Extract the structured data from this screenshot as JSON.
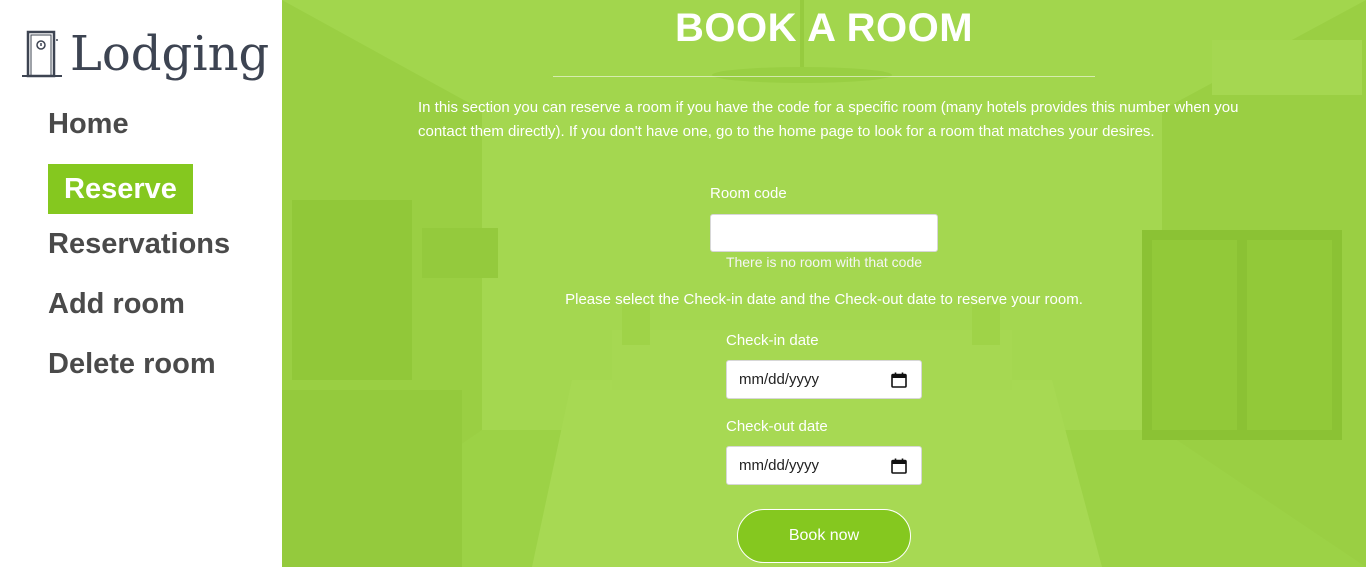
{
  "sidebar": {
    "logo_text": "Lodging",
    "nav": [
      {
        "label": "Home",
        "active": false
      },
      {
        "label": "Reserve",
        "active": true
      },
      {
        "label": "Reservations",
        "active": false
      },
      {
        "label": "Add room",
        "active": false
      },
      {
        "label": "Delete room",
        "active": false
      }
    ]
  },
  "main": {
    "title": "BOOK A ROOM",
    "intro": "In this section you can reserve a room if you have the code for a specific room (many hotels provides this number when you contact them directly). If you don't have one, go to the home page to look for a room that matches your desires.",
    "room_code_label": "Room code",
    "room_code_value": "",
    "room_code_error": "There is no room with that code",
    "dates_instructions": "Please select the Check-in date and the Check-out date to reserve your room.",
    "checkin_label": "Check-in date",
    "checkin_value": "mm/dd/yyyy",
    "checkout_label": "Check-out date",
    "checkout_value": "mm/dd/yyyy",
    "book_button": "Book now"
  },
  "colors": {
    "accent": "#85c81f",
    "overlay": "#96d232",
    "logo": "#3d4452",
    "nav_text": "#4a4a4a"
  },
  "icons": {
    "logo": "door-icon",
    "date": "calendar-icon"
  }
}
